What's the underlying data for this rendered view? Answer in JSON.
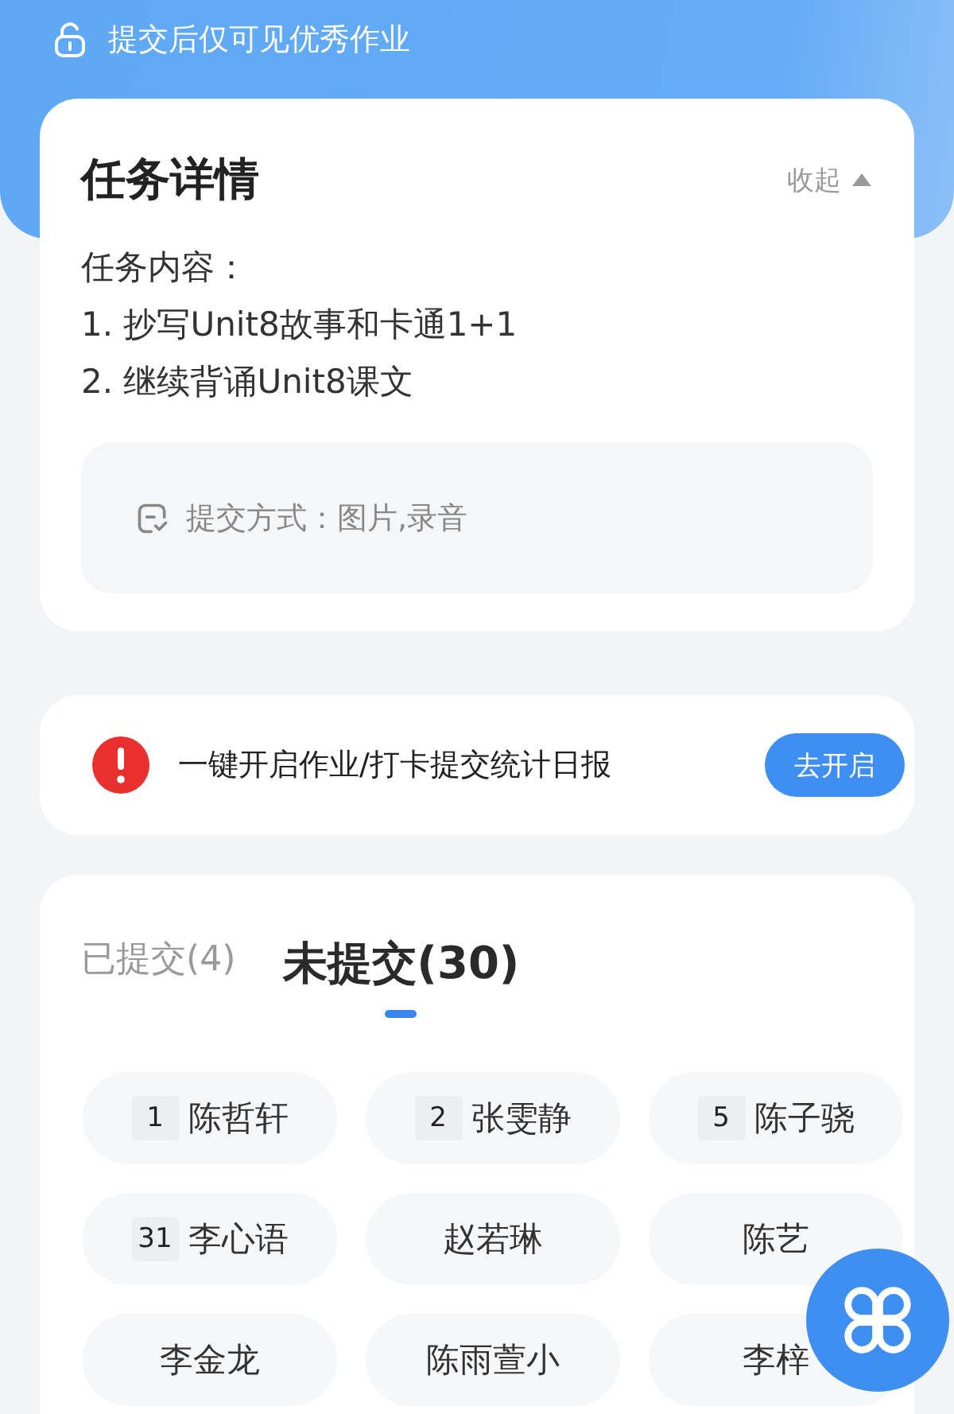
{
  "banner": {
    "text": "提交后仅可见优秀作业"
  },
  "task_card": {
    "title": "任务详情",
    "collapse_label": "收起",
    "expanded": true,
    "content_lines": [
      "任务内容：",
      "1. 抄写Unit8故事和卡通1+1",
      "2. 继续背诵Unit8课文"
    ],
    "submit_method": "提交方式：图片,录音"
  },
  "notice_card": {
    "text": "一键开启作业/打卡提交统计日报",
    "button": "去开启"
  },
  "tabs": [
    {
      "label": "已提交(4)",
      "selected": false
    },
    {
      "label": "未提交(30)",
      "selected": true
    }
  ],
  "students": [
    {
      "number": "1",
      "name": "陈哲轩"
    },
    {
      "number": "2",
      "name": "张雯静"
    },
    {
      "number": "5",
      "name": "陈子骁"
    },
    {
      "number": "31",
      "name": "李心语"
    },
    {
      "name": "赵若琳"
    },
    {
      "name": "陈艺"
    },
    {
      "name": "李金龙"
    },
    {
      "name": "陈雨萱小"
    },
    {
      "name": "李梓"
    }
  ]
}
